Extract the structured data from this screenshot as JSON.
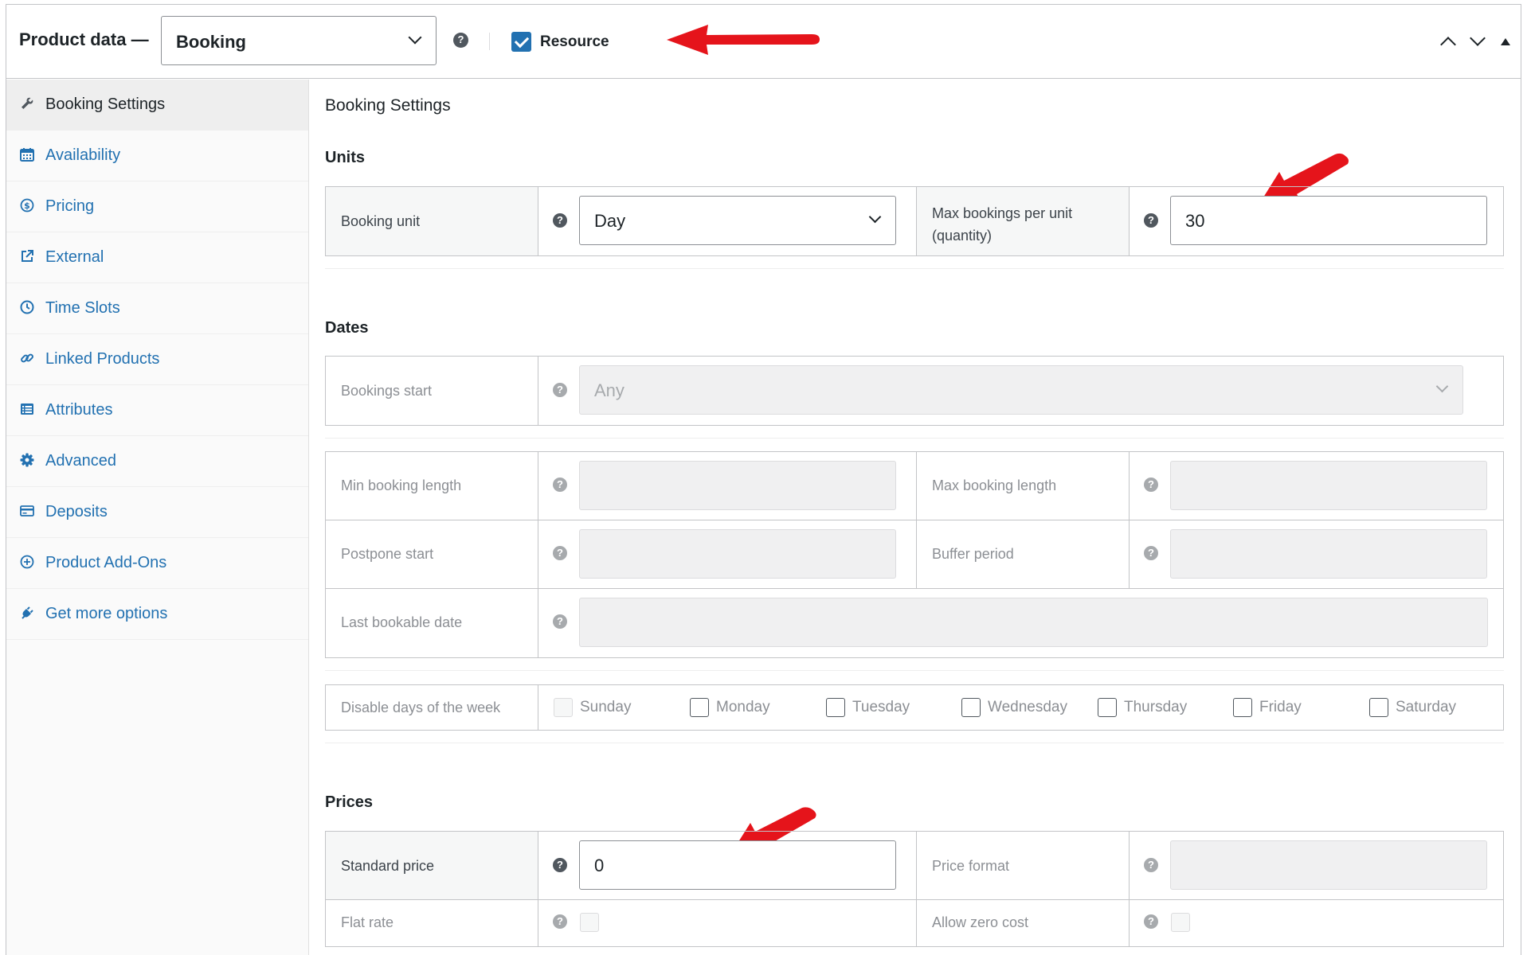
{
  "header": {
    "label": "Product data —",
    "product_type": "Booking",
    "resource_label": "Resource",
    "resource_checked": true,
    "help_glyph": "?",
    "arrow_color": "#e5141b"
  },
  "sidebar": {
    "items": [
      {
        "label": "Booking Settings",
        "icon": "wrench-icon",
        "active": true
      },
      {
        "label": "Availability",
        "icon": "calendar-icon"
      },
      {
        "label": "Pricing",
        "icon": "dollar-icon"
      },
      {
        "label": "External",
        "icon": "external-link-icon"
      },
      {
        "label": "Time Slots",
        "icon": "clock-icon"
      },
      {
        "label": "Linked Products",
        "icon": "link-icon"
      },
      {
        "label": "Attributes",
        "icon": "list-icon"
      },
      {
        "label": "Advanced",
        "icon": "gear-icon"
      },
      {
        "label": "Deposits",
        "icon": "card-icon"
      },
      {
        "label": "Product Add-Ons",
        "icon": "plus-circle-icon"
      },
      {
        "label": "Get more options",
        "icon": "plugin-icon"
      }
    ]
  },
  "main": {
    "title": "Booking Settings",
    "units": {
      "title": "Units",
      "booking_unit_label": "Booking unit",
      "booking_unit_value": "Day",
      "max_bookings_label_1": "Max bookings per unit",
      "max_bookings_label_2": "(quantity)",
      "max_bookings_value": "30"
    },
    "dates": {
      "title": "Dates",
      "bookings_start_label": "Bookings start",
      "bookings_start_value": "Any",
      "min_length_label": "Min booking length",
      "max_length_label": "Max booking length",
      "postpone_label": "Postpone start",
      "buffer_label": "Buffer period",
      "last_date_label": "Last bookable date",
      "disable_days_label": "Disable days of the week",
      "days": [
        "Sunday",
        "Monday",
        "Tuesday",
        "Wednesday",
        "Thursday",
        "Friday",
        "Saturday"
      ]
    },
    "prices": {
      "title": "Prices",
      "standard_label": "Standard price",
      "standard_value": "0",
      "format_label": "Price format",
      "flat_label": "Flat rate",
      "zero_label": "Allow zero cost"
    }
  }
}
